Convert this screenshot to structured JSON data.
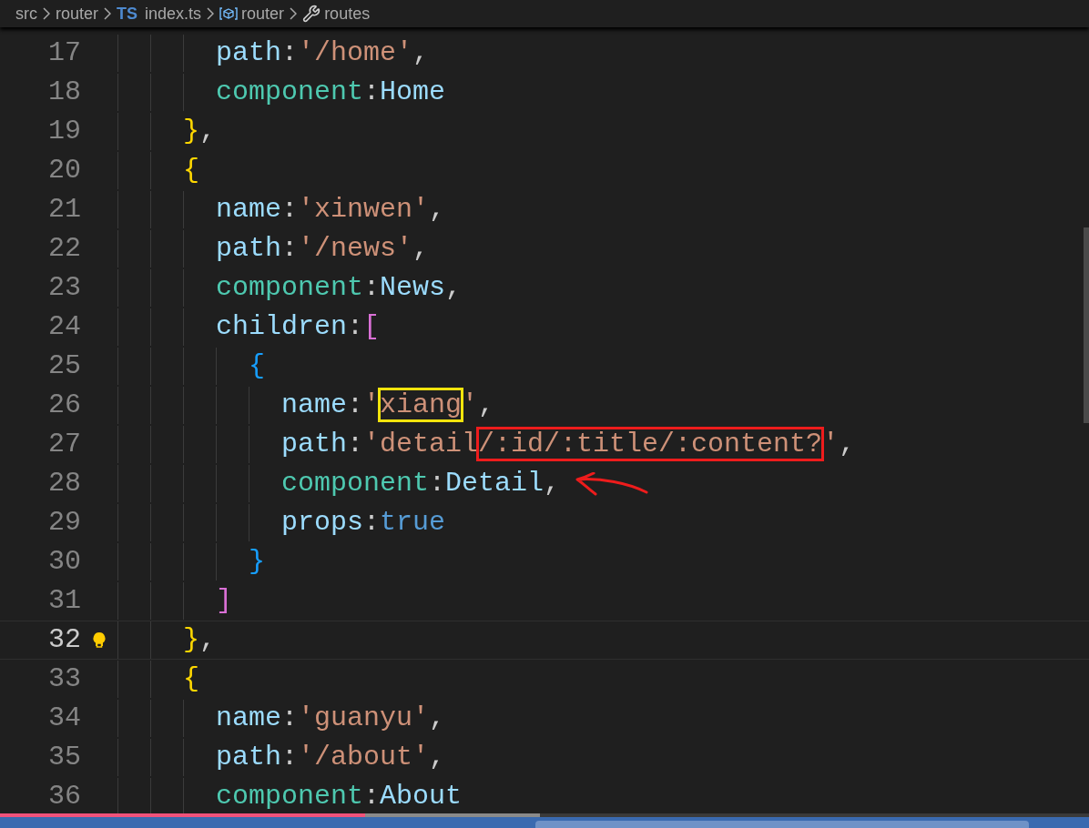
{
  "breadcrumb": [
    {
      "kind": "text",
      "text": "src"
    },
    {
      "kind": "text",
      "text": "router"
    },
    {
      "kind": "file",
      "badge": "TS",
      "text": "index.ts"
    },
    {
      "kind": "variable",
      "text": "router"
    },
    {
      "kind": "property",
      "text": "routes"
    }
  ],
  "lines": [
    {
      "children": [
        {
          "number": "17",
          "tokens": [
            {
              "text": "path",
              "kind": "key"
            },
            {
              "text": ":",
              "kind": "punct"
            },
            {
              "text": "'/home'",
              "kind": "string"
            },
            {
              "text": ",",
              "kind": "punct"
            }
          ]
        },
        {
          "number": "18",
          "tokens": [
            {
              "text": "component",
              "kind": "prop"
            },
            {
              "text": ":",
              "kind": "punct"
            },
            {
              "text": "Home",
              "kind": "ident"
            }
          ]
        }
      ]
    },
    {
      "number": "19",
      "tokens": [
        {
          "text": "}",
          "kind": "brace1"
        },
        {
          "text": ",",
          "kind": "punct"
        }
      ]
    },
    {
      "number": "20",
      "tokens": [
        {
          "text": "{",
          "kind": "brace1"
        }
      ],
      "children": [
        {
          "number": "21",
          "tokens": [
            {
              "text": "name",
              "kind": "key"
            },
            {
              "text": ":",
              "kind": "punct"
            },
            {
              "text": "'xinwen'",
              "kind": "string"
            },
            {
              "text": ",",
              "kind": "punct"
            }
          ]
        },
        {
          "number": "22",
          "tokens": [
            {
              "text": "path",
              "kind": "key"
            },
            {
              "text": ":",
              "kind": "punct"
            },
            {
              "text": "'/news'",
              "kind": "string"
            },
            {
              "text": ",",
              "kind": "punct"
            }
          ]
        },
        {
          "number": "23",
          "tokens": [
            {
              "text": "component",
              "kind": "prop"
            },
            {
              "text": ":",
              "kind": "punct"
            },
            {
              "text": "News",
              "kind": "ident"
            },
            {
              "text": ",",
              "kind": "punct"
            }
          ]
        },
        {
          "number": "24",
          "tokens": [
            {
              "text": "children",
              "kind": "key"
            },
            {
              "text": ":",
              "kind": "punct"
            },
            {
              "text": "[",
              "kind": "brace2"
            }
          ],
          "children": [
            {
              "number": "25",
              "tokens": [
                {
                  "text": "{",
                  "kind": "brace3"
                }
              ],
              "children": [
                {
                  "number": "26",
                  "tokens": [
                    {
                      "text": "name",
                      "kind": "key"
                    },
                    {
                      "text": ":",
                      "kind": "punct"
                    },
                    {
                      "text": "'",
                      "kind": "string"
                    },
                    {
                      "text": "xiang",
                      "kind": "string",
                      "color": "#f2e40c"
                    },
                    {
                      "text": "'",
                      "kind": "string"
                    },
                    {
                      "text": ",",
                      "kind": "punct"
                    }
                  ]
                },
                {
                  "number": "27",
                  "tokens": [
                    {
                      "text": "path",
                      "kind": "key"
                    },
                    {
                      "text": ":",
                      "kind": "punct"
                    },
                    {
                      "text": "'detail",
                      "kind": "string"
                    },
                    {
                      "text": "/:id/:title/:content?",
                      "kind": "string",
                      "color": "#ee1c1c"
                    },
                    {
                      "text": "'",
                      "kind": "string"
                    },
                    {
                      "text": ",",
                      "kind": "punct"
                    }
                  ]
                },
                {
                  "number": "28",
                  "arrow": true,
                  "tokens": [
                    {
                      "text": "component",
                      "kind": "prop"
                    },
                    {
                      "text": ":",
                      "kind": "punct"
                    },
                    {
                      "text": "Detail",
                      "kind": "ident"
                    },
                    {
                      "text": ",",
                      "kind": "punct"
                    }
                  ]
                },
                {
                  "number": "29",
                  "tokens": [
                    {
                      "text": "props",
                      "kind": "key"
                    },
                    {
                      "text": ":",
                      "kind": "punct"
                    },
                    {
                      "text": "true",
                      "kind": "keyword"
                    }
                  ]
                }
              ]
            },
            {
              "number": "30",
              "tokens": [
                {
                  "text": "}",
                  "kind": "brace3"
                }
              ]
            }
          ]
        },
        {
          "number": "31",
          "tokens": [
            {
              "text": "]",
              "kind": "brace2"
            }
          ]
        }
      ]
    },
    {
      "number": "32",
      "current": true,
      "lightbulb": true,
      "tokens": [
        {
          "text": "}",
          "kind": "brace1"
        },
        {
          "text": ",",
          "kind": "punct"
        }
      ]
    },
    {
      "number": "33",
      "tokens": [
        {
          "text": "{",
          "kind": "brace1"
        }
      ],
      "children": [
        {
          "number": "34",
          "tokens": [
            {
              "text": "name",
              "kind": "key"
            },
            {
              "text": ":",
              "kind": "punct"
            },
            {
              "text": "'guanyu'",
              "kind": "string"
            },
            {
              "text": ",",
              "kind": "punct"
            }
          ]
        },
        {
          "number": "35",
          "tokens": [
            {
              "text": "path",
              "kind": "key"
            },
            {
              "text": ":",
              "kind": "punct"
            },
            {
              "text": "'/about'",
              "kind": "string"
            },
            {
              "text": ",",
              "kind": "punct"
            }
          ]
        },
        {
          "number": "36",
          "tokens": [
            {
              "text": "component",
              "kind": "prop"
            },
            {
              "text": ":",
              "kind": "punct"
            },
            {
              "text": "About",
              "kind": "ident"
            }
          ]
        }
      ]
    }
  ],
  "video_progress": {
    "played": {
      "level": 0.335
    },
    "buffered": {
      "level": 0.496
    }
  }
}
